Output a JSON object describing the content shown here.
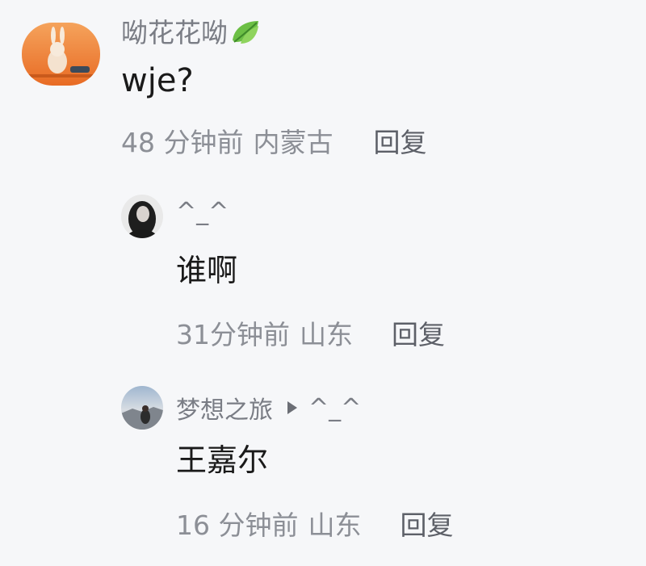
{
  "colors": {
    "background": "#f6f7f9",
    "username": "#7a7d85",
    "content": "#1a1a1a",
    "meta": "#8c8f96",
    "reply": "#5d6068"
  },
  "comments": [
    {
      "avatar": "rabbit-avatar",
      "username": "呦花花呦",
      "badge_icon": "leaf-icon",
      "text": "wje?",
      "time": "48 分钟前",
      "location": "内蒙古",
      "reply_label": "回复"
    },
    {
      "avatar": "girl-avatar",
      "username": "^_^",
      "text": "谁啊",
      "time": "31分钟前",
      "location": "山东",
      "reply_label": "回复"
    },
    {
      "avatar": "landscape-avatar",
      "username": "梦想之旅",
      "reply_arrow_icon": "triangle-right-icon",
      "reply_to": "^_^",
      "text": "王嘉尔",
      "time": "16 分钟前",
      "location": "山东",
      "reply_label": "回复"
    }
  ]
}
